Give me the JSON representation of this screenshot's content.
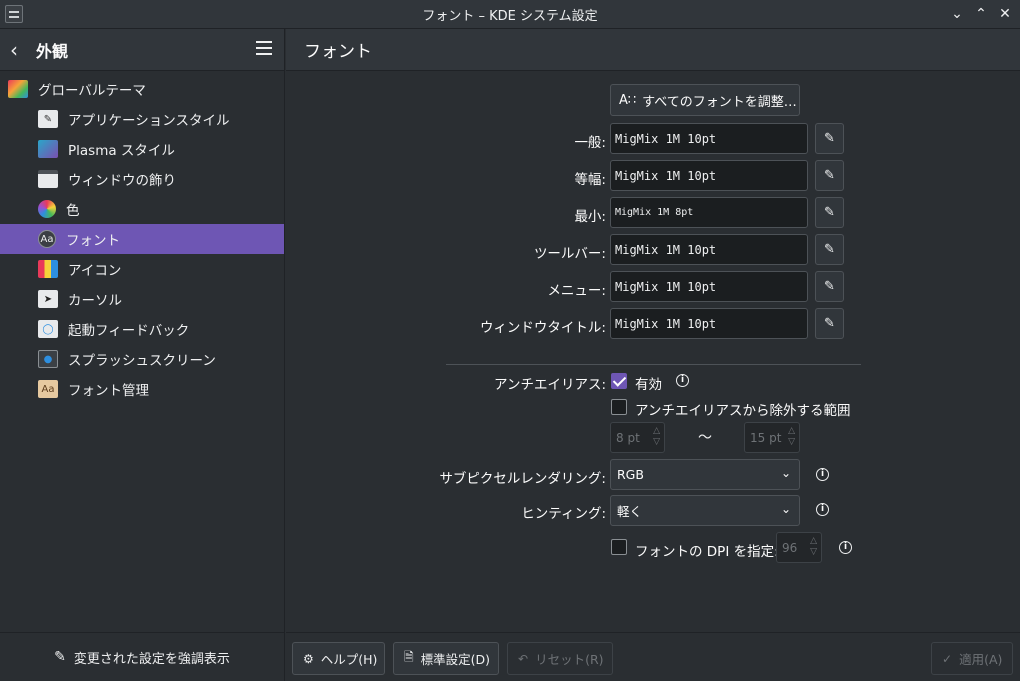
{
  "window": {
    "title": "フォント – KDE システム設定",
    "controls": [
      "minimize-icon",
      "maximize-icon",
      "close-icon"
    ]
  },
  "sidebar": {
    "back_label": "外観",
    "items": [
      {
        "label": "グローバルテーマ",
        "icon": "global-theme-icon",
        "level": "top"
      },
      {
        "label": "アプリケーションスタイル",
        "icon": "app-style-icon",
        "level": "sub"
      },
      {
        "label": "Plasma スタイル",
        "icon": "plasma-style-icon",
        "level": "sub"
      },
      {
        "label": "ウィンドウの飾り",
        "icon": "window-decoration-icon",
        "level": "sub"
      },
      {
        "label": "色",
        "icon": "color-icon",
        "level": "sub"
      },
      {
        "label": "フォント",
        "icon": "font-icon",
        "level": "sub",
        "active": true
      },
      {
        "label": "アイコン",
        "icon": "icons-icon",
        "level": "sub"
      },
      {
        "label": "カーソル",
        "icon": "cursor-icon",
        "level": "sub"
      },
      {
        "label": "起動フィードバック",
        "icon": "launch-feedback-icon",
        "level": "sub"
      },
      {
        "label": "スプラッシュスクリーン",
        "icon": "splash-screen-icon",
        "level": "sub"
      },
      {
        "label": "フォント管理",
        "icon": "font-management-icon",
        "level": "sub"
      }
    ],
    "footer_label": "変更された設定を強調表示"
  },
  "main": {
    "title": "フォント",
    "adjust_all_label": "すべてのフォントを調整…",
    "fonts": [
      {
        "label": "一般:",
        "value": "MigMix 1M 10pt"
      },
      {
        "label": "等幅:",
        "value": "MigMix 1M 10pt"
      },
      {
        "label": "最小:",
        "value": "MigMix 1M 8pt"
      },
      {
        "label": "ツールバー:",
        "value": "MigMix 1M 10pt"
      },
      {
        "label": "メニュー:",
        "value": "MigMix 1M 10pt"
      },
      {
        "label": "ウィンドウタイトル:",
        "value": "MigMix 1M 10pt"
      }
    ],
    "antialias": {
      "label": "アンチエイリアス:",
      "enabled_label": "有効",
      "enabled": true,
      "exclude_label": "アンチエイリアスから除外する範囲",
      "exclude": false,
      "range_from": "8 pt",
      "range_sep": "〜",
      "range_to": "15 pt"
    },
    "subpixel": {
      "label": "サブピクセルレンダリング:",
      "value": "RGB"
    },
    "hinting": {
      "label": "ヒンティング:",
      "value": "軽く"
    },
    "dpi": {
      "label": "フォントの DPI を指定:",
      "checked": false,
      "value": "96"
    }
  },
  "buttons": {
    "help": "ヘルプ(H)",
    "defaults": "標準設定(D)",
    "reset": "リセット(R)",
    "apply": "適用(A)"
  },
  "colors": {
    "accent": "#6e56b4",
    "background": "#2a2e32",
    "header": "#31363b"
  }
}
